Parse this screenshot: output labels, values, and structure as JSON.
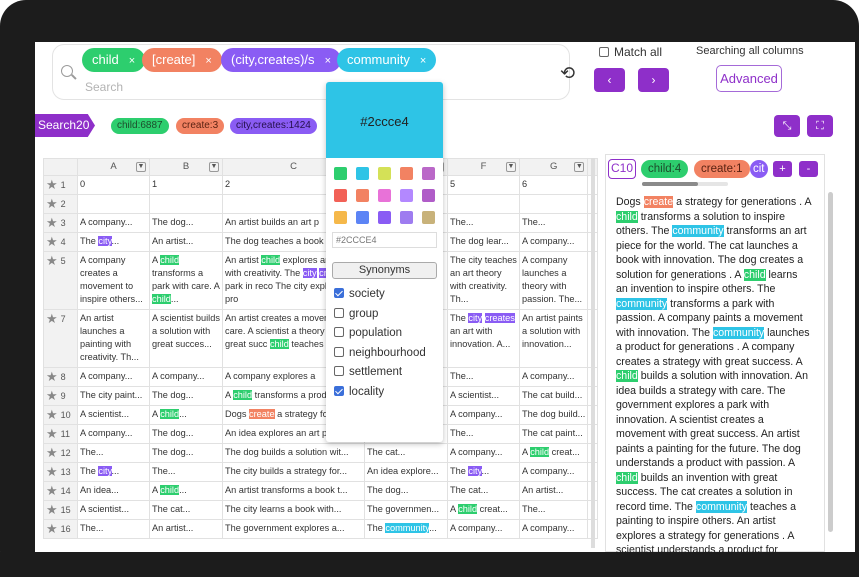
{
  "search": {
    "chips": [
      {
        "label": "child",
        "color": "green"
      },
      {
        "label": "[create]",
        "color": "orange"
      },
      {
        "label": "(city,creates)/s",
        "color": "purple"
      },
      {
        "label": "community",
        "color": "cyan"
      }
    ],
    "close_glyph": "×",
    "placeholder": "Search",
    "match_all": "Match all",
    "searching": "Searching all columns",
    "prev": "‹",
    "next": "›",
    "advanced": "Advanced"
  },
  "results": {
    "tag": "Search20",
    "pills": [
      "child:6887",
      "create:3",
      "city,creates:1424"
    ]
  },
  "grid": {
    "columns": [
      "A",
      "B",
      "C",
      "D",
      "E",
      "F",
      "G"
    ],
    "row1": [
      "0",
      "1",
      "2",
      "",
      "",
      "5",
      "6"
    ]
  },
  "picker": {
    "hex": "#2ccce4",
    "input": "#2CCCE4",
    "synonyms_label": "Synonyms",
    "synonyms": [
      {
        "label": "society",
        "checked": true
      },
      {
        "label": "group",
        "checked": false
      },
      {
        "label": "population",
        "checked": false
      },
      {
        "label": "neighbourhood",
        "checked": false
      },
      {
        "label": "settlement",
        "checked": false
      },
      {
        "label": "locality",
        "checked": true
      }
    ],
    "swatches": [
      "#2dce6e",
      "#2ec4e6",
      "#d4e157",
      "#f28262",
      "#ba68c8",
      "#f26157",
      "#f28262",
      "#e872d8",
      "#b388ff",
      "#b05cc8",
      "#f5b84a",
      "#5c84f5",
      "#8a5cf4",
      "#9e7cf0",
      "#c8b27a"
    ]
  },
  "panel": {
    "cell": "C10",
    "chips": [
      "child:4",
      "create:1",
      "cit"
    ],
    "plus": "+",
    "minus": "-",
    "progress": 0.65
  },
  "colors": {
    "accent": "#8e2fc9",
    "green": "#2dce6e",
    "orange": "#f28262",
    "purple": "#8a5cf4",
    "cyan": "#2ec4e6"
  }
}
